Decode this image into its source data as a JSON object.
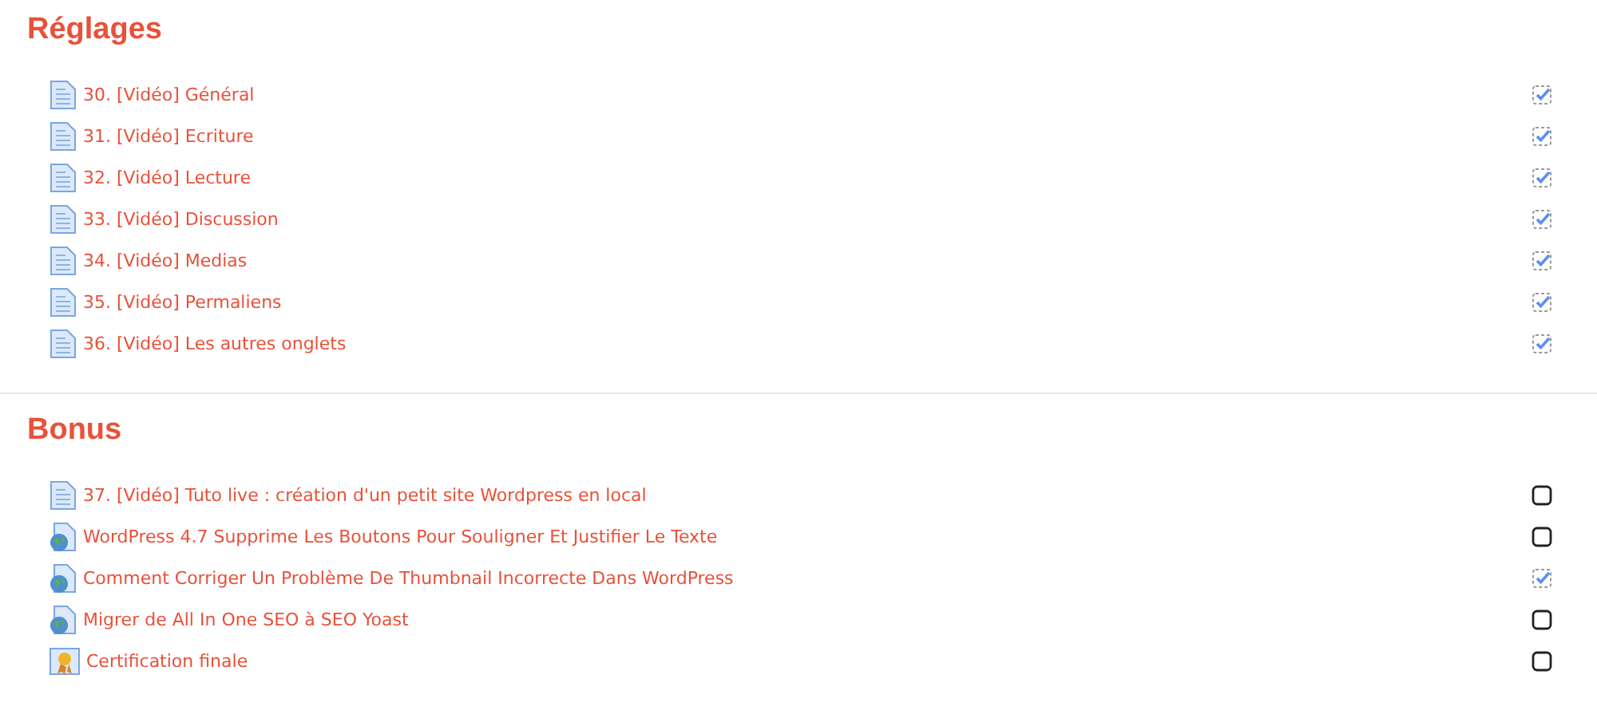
{
  "sections": [
    {
      "title": "Réglages",
      "items": [
        {
          "kind": "page",
          "label": "30. [Vidéo] Général",
          "checked": true
        },
        {
          "kind": "page",
          "label": "31. [Vidéo] Ecriture",
          "checked": true
        },
        {
          "kind": "page",
          "label": "32. [Vidéo] Lecture",
          "checked": true
        },
        {
          "kind": "page",
          "label": "33. [Vidéo] Discussion",
          "checked": true
        },
        {
          "kind": "page",
          "label": "34. [Vidéo] Medias",
          "checked": true
        },
        {
          "kind": "page",
          "label": "35. [Vidéo] Permaliens",
          "checked": true
        },
        {
          "kind": "page",
          "label": "36. [Vidéo] Les autres onglets",
          "checked": true
        }
      ]
    },
    {
      "title": "Bonus",
      "items": [
        {
          "kind": "page",
          "label": "37. [Vidéo] Tuto live : création d'un petit site Wordpress en local",
          "checked": false
        },
        {
          "kind": "web",
          "label": "WordPress 4.7 Supprime Les Boutons Pour Souligner Et Justifier Le Texte",
          "checked": false
        },
        {
          "kind": "web",
          "label": "Comment Corriger Un Problème De Thumbnail Incorrecte Dans WordPress",
          "checked": true
        },
        {
          "kind": "web",
          "label": "Migrer de All In One SEO à SEO Yoast",
          "checked": false
        },
        {
          "kind": "award",
          "label": "Certification finale",
          "checked": false
        }
      ]
    }
  ]
}
